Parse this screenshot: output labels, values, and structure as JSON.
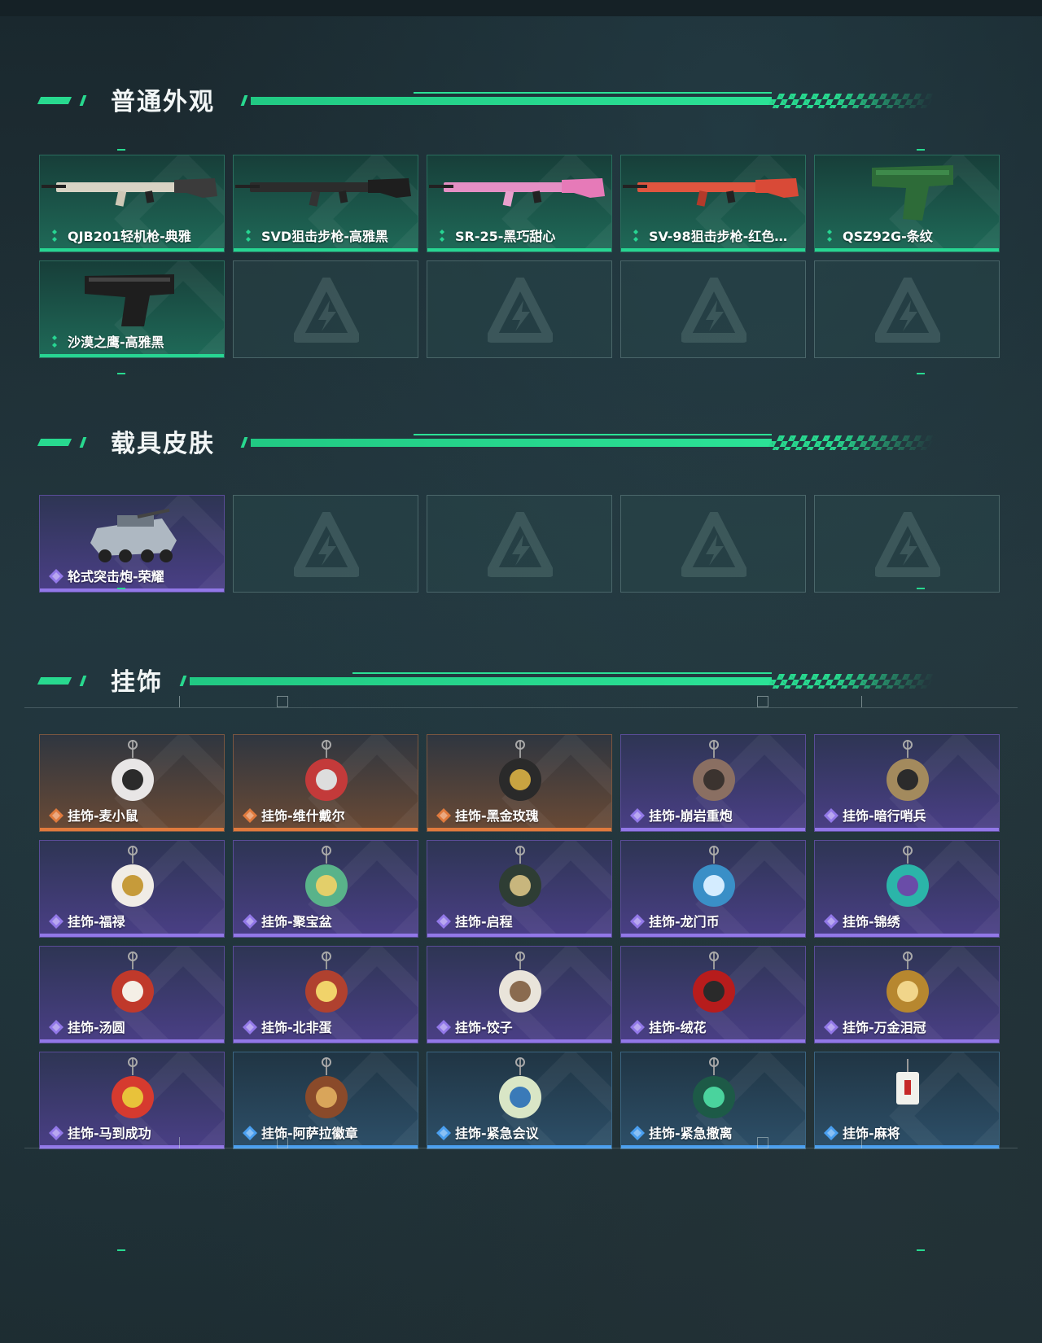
{
  "sections": [
    {
      "title": "普通外观",
      "items": [
        {
          "label": "QJB201轻机枪-典雅",
          "rarity": "green",
          "icon": "machine-gun"
        },
        {
          "label": "SVD狙击步枪-高雅黑",
          "rarity": "green",
          "icon": "sniper-rifle"
        },
        {
          "label": "SR-25-黑巧甜心",
          "rarity": "green",
          "icon": "pink-rifle"
        },
        {
          "label": "SV-98狙击步枪-红色…",
          "rarity": "green",
          "icon": "red-sniper-rifle"
        },
        {
          "label": "QSZ92G-条纹",
          "rarity": "green",
          "icon": "green-pistol"
        },
        {
          "label": "沙漠之鹰-高雅黑",
          "rarity": "green",
          "icon": "black-pistol"
        },
        {
          "label": "",
          "rarity": "empty",
          "icon": "placeholder-logo"
        },
        {
          "label": "",
          "rarity": "empty",
          "icon": "placeholder-logo"
        },
        {
          "label": "",
          "rarity": "empty",
          "icon": "placeholder-logo"
        },
        {
          "label": "",
          "rarity": "empty",
          "icon": "placeholder-logo"
        }
      ]
    },
    {
      "title": "载具皮肤",
      "items": [
        {
          "label": "轮式突击炮-荣耀",
          "rarity": "purple",
          "icon": "armored-vehicle"
        },
        {
          "label": "",
          "rarity": "empty",
          "icon": "placeholder-logo"
        },
        {
          "label": "",
          "rarity": "empty",
          "icon": "placeholder-logo"
        },
        {
          "label": "",
          "rarity": "empty",
          "icon": "placeholder-logo"
        },
        {
          "label": "",
          "rarity": "empty",
          "icon": "placeholder-logo"
        }
      ]
    },
    {
      "title": "挂饰",
      "items": [
        {
          "label": "挂饰-麦小鼠",
          "rarity": "orange",
          "icon": "mouse-charm"
        },
        {
          "label": "挂饰-维什戴尔",
          "rarity": "orange",
          "icon": "figure-charm"
        },
        {
          "label": "挂饰-黑金玫瑰",
          "rarity": "orange",
          "icon": "rose-charm"
        },
        {
          "label": "挂饰-崩岩重炮",
          "rarity": "purple",
          "icon": "soldier-charm"
        },
        {
          "label": "挂饰-暗行哨兵",
          "rarity": "purple",
          "icon": "sentinel-charm"
        },
        {
          "label": "挂饰-福禄",
          "rarity": "purple",
          "icon": "gourd-charm"
        },
        {
          "label": "挂饰-聚宝盆",
          "rarity": "purple",
          "icon": "treasure-bowl-charm"
        },
        {
          "label": "挂饰-启程",
          "rarity": "purple",
          "icon": "medal-charm"
        },
        {
          "label": "挂饰-龙门币",
          "rarity": "purple",
          "icon": "coin-charm"
        },
        {
          "label": "挂饰-锦绣",
          "rarity": "purple",
          "icon": "butterfly-charm"
        },
        {
          "label": "挂饰-汤圆",
          "rarity": "purple",
          "icon": "dumpling-bowl-charm"
        },
        {
          "label": "挂饰-北非蛋",
          "rarity": "purple",
          "icon": "egg-dish-charm"
        },
        {
          "label": "挂饰-饺子",
          "rarity": "purple",
          "icon": "dumpling-charm"
        },
        {
          "label": "挂饰-绒花",
          "rarity": "purple",
          "icon": "flower-charm"
        },
        {
          "label": "挂饰-万金泪冠",
          "rarity": "purple",
          "icon": "burger-charm"
        },
        {
          "label": "挂饰-马到成功",
          "rarity": "purple",
          "icon": "horse-charm"
        },
        {
          "label": "挂饰-阿萨拉徽章",
          "rarity": "blue",
          "icon": "badge-charm"
        },
        {
          "label": "挂饰-紧急会议",
          "rarity": "blue",
          "icon": "meeting-charm"
        },
        {
          "label": "挂饰-紧急撤离",
          "rarity": "blue",
          "icon": "evac-charm"
        },
        {
          "label": "挂饰-麻将",
          "rarity": "blue",
          "icon": "mahjong-charm"
        }
      ]
    }
  ],
  "colors": {
    "accent": "#28d98f",
    "green": "#27d592",
    "purple": "#9278e8",
    "orange": "#e07a3d",
    "blue": "#4a9ff0"
  }
}
